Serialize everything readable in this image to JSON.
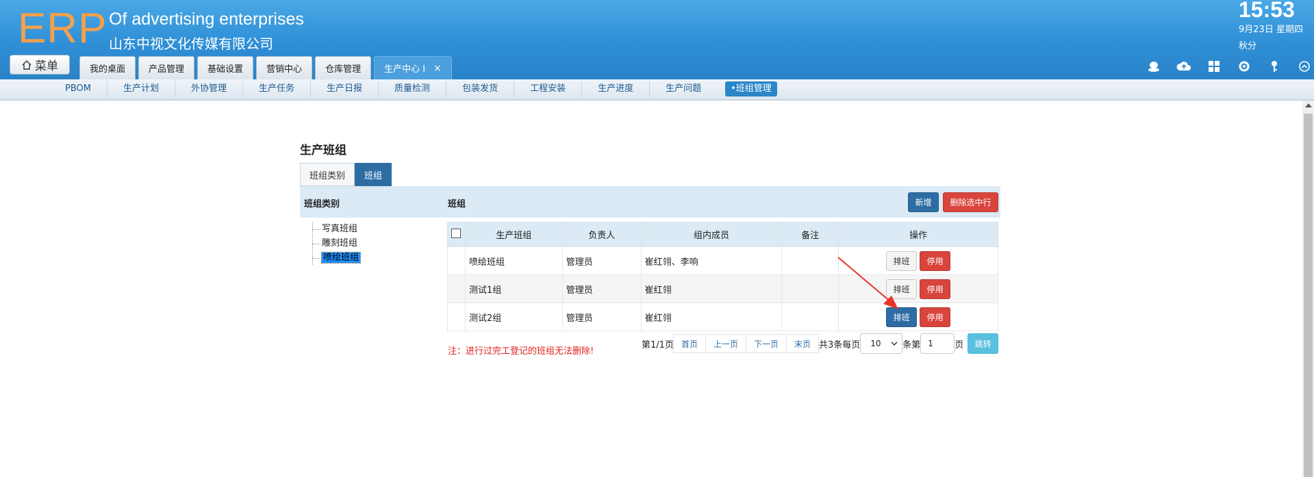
{
  "header": {
    "logo": "ERP",
    "company_en": "Of advertising enterprises",
    "company_cn": "山东中视文化传媒有限公司",
    "clock": "15:53",
    "date": "9月23日 星期四",
    "season": "秋分",
    "menu_label": "菜单"
  },
  "top_tabs": [
    "我的桌面",
    "产品管理",
    "基础设置",
    "营销中心",
    "仓库管理"
  ],
  "top_tab_active": "生产中心 I",
  "top_tab_close": "×",
  "right_icons": [
    "user-status-icon",
    "cloud-icon",
    "grid-icon",
    "gear-icon",
    "key-icon",
    "collapse-icon"
  ],
  "subnav": {
    "items": [
      "PBOM",
      "生产计划",
      "外协管理",
      "生产任务",
      "生产日报",
      "质量检测",
      "包装发货",
      "工程安装",
      "生产进度",
      "生产问题"
    ],
    "active": "•班组管理"
  },
  "page": {
    "title": "生产班组",
    "tabs": [
      "班组类别",
      "班组"
    ],
    "section_left": "班组类别",
    "section_right": "班组",
    "add_label": "新增",
    "delete_label": "删除选中行"
  },
  "tree": [
    "写真班组",
    "雕刻班组",
    "喷绘班组"
  ],
  "table": {
    "headers": [
      "生产班组",
      "负责人",
      "组内成员",
      "备注",
      "操作"
    ],
    "rows": [
      {
        "name": "喷绘班组",
        "leader": "管理员",
        "members": "崔红翎、李响",
        "note": "",
        "schedule": "排班",
        "stop": "停用"
      },
      {
        "name": "测试1组",
        "leader": "管理员",
        "members": "崔红翎",
        "note": "",
        "schedule": "排班",
        "stop": "停用"
      },
      {
        "name": "测试2组",
        "leader": "管理员",
        "members": "崔红翎",
        "note": "",
        "schedule": "排班",
        "stop": "停用"
      }
    ]
  },
  "note": "注：进行过完工登记的班组无法删除!",
  "pager": {
    "page_info": "第1/1页",
    "first": "首页",
    "prev": "上一页",
    "next": "下一页",
    "last": "末页",
    "total_text": "共3条每页",
    "page_size": "10",
    "goto_prefix": "条第",
    "goto_value": "1",
    "goto_suffix": "页",
    "jump": "跳转"
  },
  "colors": {
    "header": "#2f8fd6",
    "logo": "#f5a04a",
    "primary": "#2e6da4",
    "danger": "#d9443c",
    "info": "#5bc0de",
    "annotation": "#e8332a"
  }
}
